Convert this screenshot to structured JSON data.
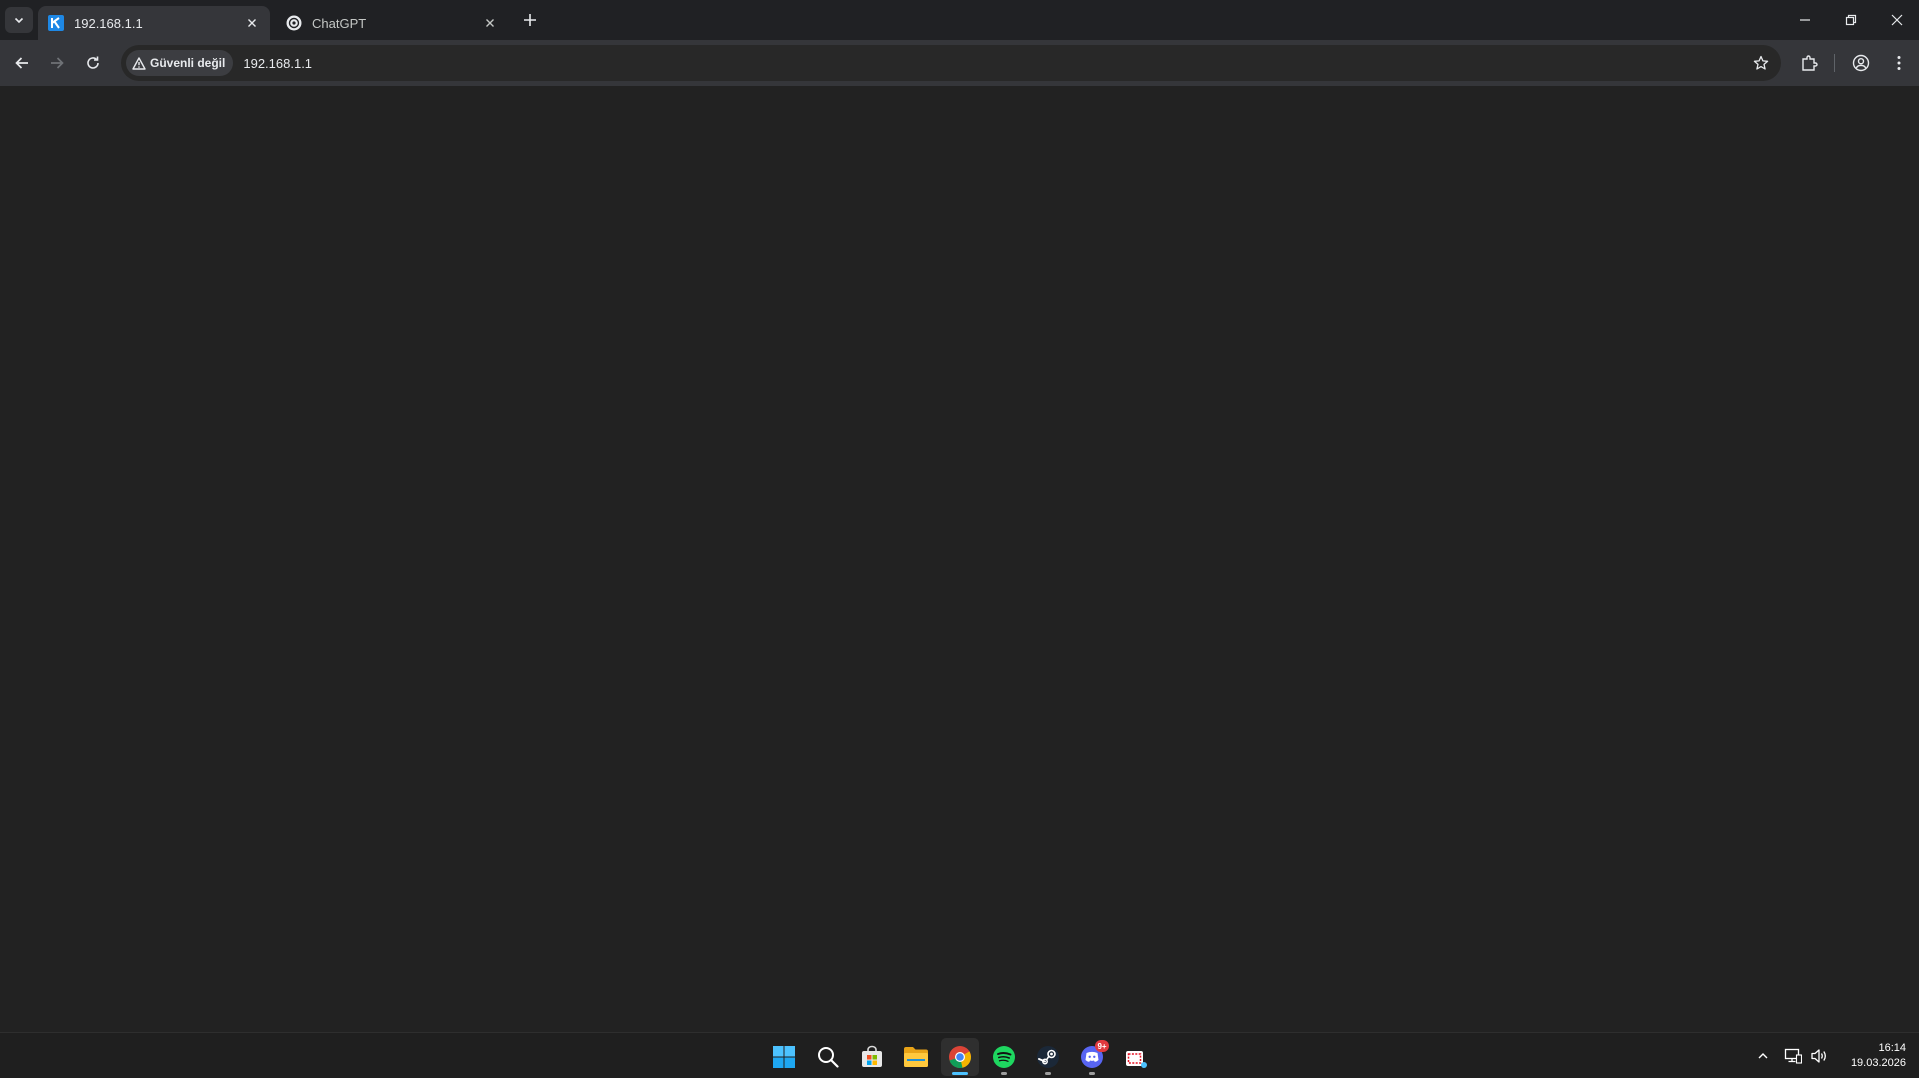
{
  "browser": {
    "tabs": [
      {
        "title": "192.168.1.1",
        "active": true,
        "favicon": "keenetic-k-icon"
      },
      {
        "title": "ChatGPT",
        "active": false,
        "favicon": "chatgpt-icon"
      }
    ],
    "security_chip": "Güvenli değil",
    "url": "192.168.1.1",
    "colors": {
      "frame": "#202124",
      "toolbar": "#35363a",
      "omnibox": "#282828",
      "content": "#222222"
    }
  },
  "taskbar": {
    "apps": [
      {
        "name": "start-icon"
      },
      {
        "name": "search-icon"
      },
      {
        "name": "microsoft-store-icon"
      },
      {
        "name": "file-explorer-icon"
      },
      {
        "name": "chrome-icon",
        "active": true
      },
      {
        "name": "spotify-icon"
      },
      {
        "name": "steam-icon"
      },
      {
        "name": "discord-icon",
        "badge": "9+"
      },
      {
        "name": "snipping-tool-icon"
      }
    ],
    "clock": {
      "time": "16:14",
      "date": "19.03.2026"
    }
  }
}
